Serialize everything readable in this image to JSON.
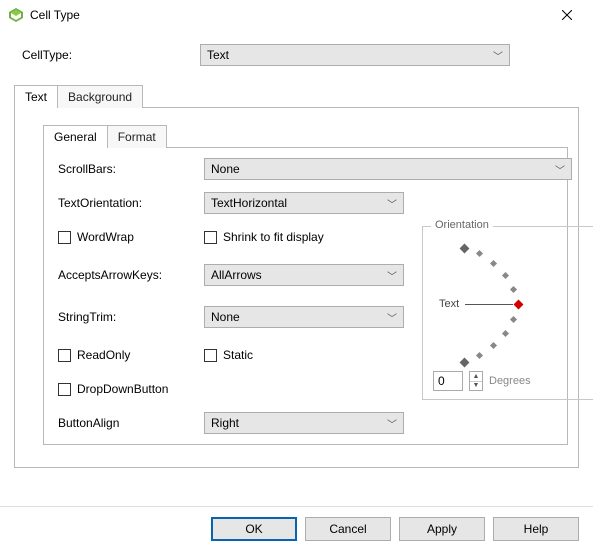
{
  "window": {
    "title": "Cell Type"
  },
  "cellType": {
    "label": "CellType:",
    "value": "Text"
  },
  "tabs": {
    "text": "Text",
    "background": "Background"
  },
  "subtabs": {
    "general": "General",
    "format": "Format"
  },
  "general": {
    "scrollBarsLabel": "ScrollBars:",
    "scrollBarsValue": "None",
    "textOrientationLabel": "TextOrientation:",
    "textOrientationValue": "TextHorizontal",
    "wordWrap": "WordWrap",
    "shrinkToFit": "Shrink to fit display",
    "acceptsArrowKeysLabel": "AcceptsArrowKeys:",
    "acceptsArrowKeysValue": "AllArrows",
    "stringTrimLabel": "StringTrim:",
    "stringTrimValue": "None",
    "readOnly": "ReadOnly",
    "static": "Static",
    "dropDownButton": "DropDownButton",
    "buttonAlignLabel": "ButtonAlign",
    "buttonAlignValue": "Right"
  },
  "orientation": {
    "legend": "Orientation",
    "text": "Text",
    "degreesValue": "0",
    "degreesLabel": "Degrees"
  },
  "buttons": {
    "ok": "OK",
    "cancel": "Cancel",
    "apply": "Apply",
    "help": "Help"
  }
}
